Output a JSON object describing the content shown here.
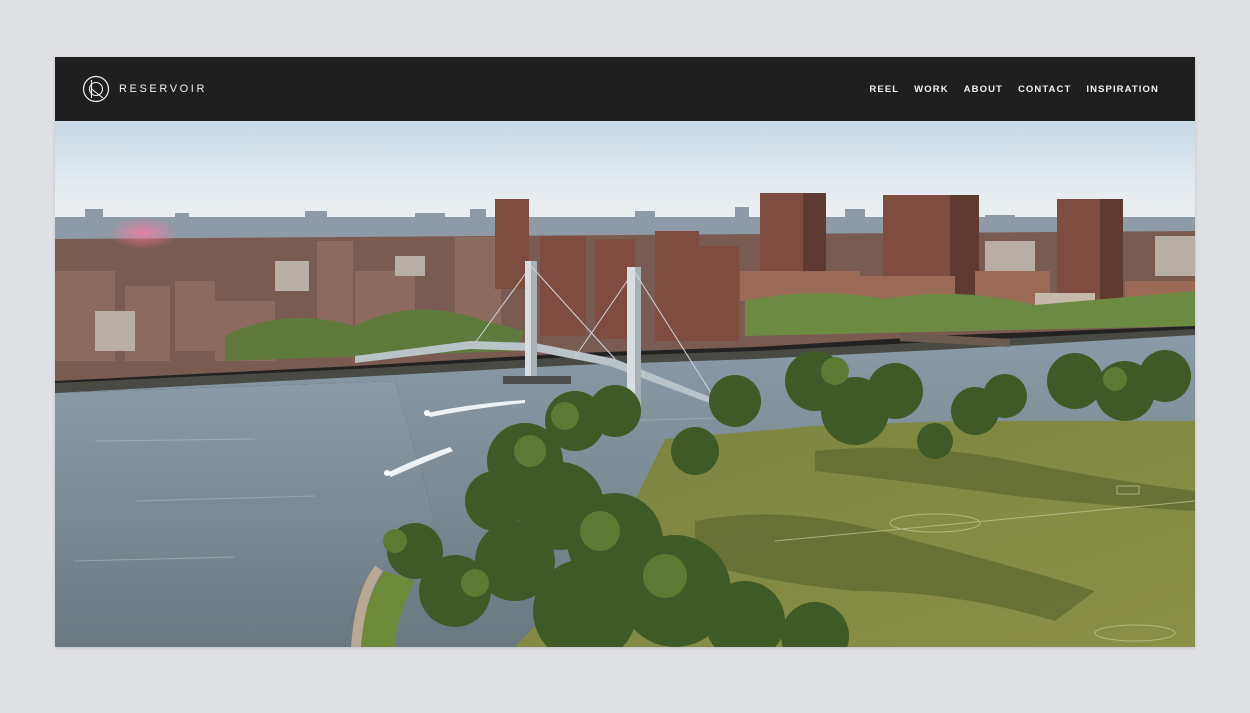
{
  "header": {
    "brand_name": "RESERVOIR",
    "logo_icon": "reservoir-circle-logo-icon",
    "nav_items": [
      {
        "label": "REEL"
      },
      {
        "label": "WORK"
      },
      {
        "label": "ABOUT"
      },
      {
        "label": "CONTACT"
      },
      {
        "label": "INSPIRATION"
      }
    ]
  },
  "hero": {
    "media": "aerial-city-river-bridge-park-video"
  },
  "colors": {
    "nav_background": "#1f1f1f",
    "nav_text": "#f2f2f2",
    "page_background": "#dfe0e4"
  }
}
